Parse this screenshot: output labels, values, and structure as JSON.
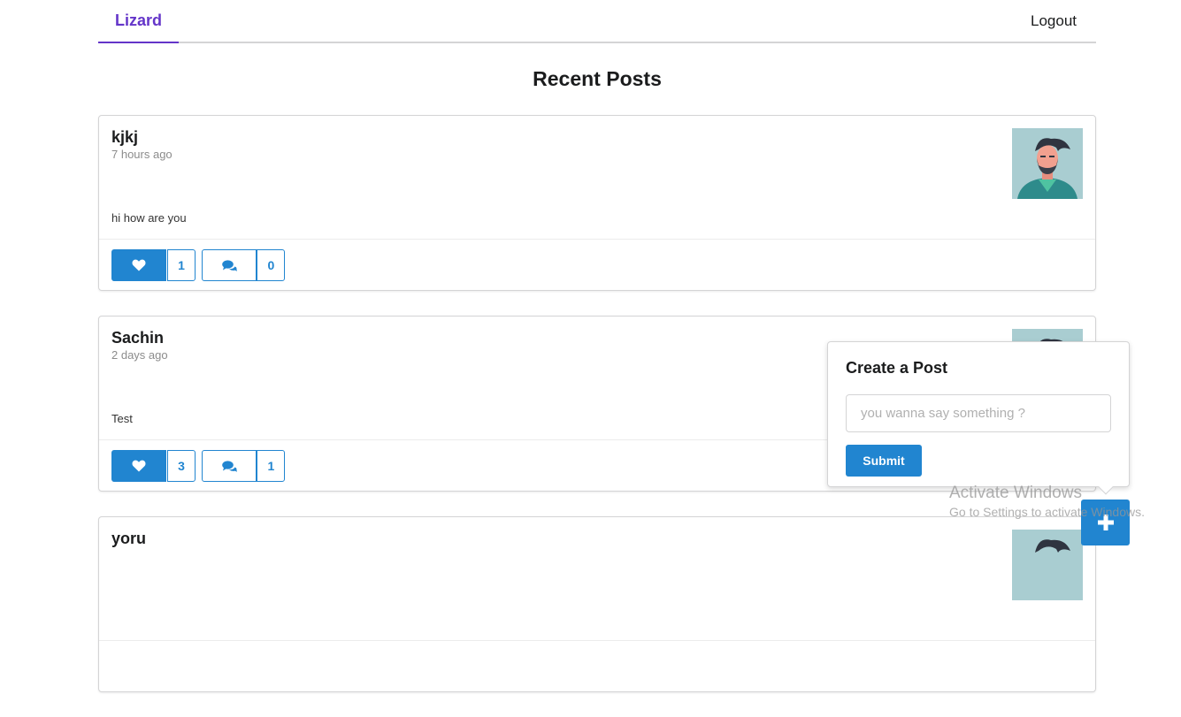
{
  "nav": {
    "brand": "Lizard",
    "logout": "Logout"
  },
  "page": {
    "title": "Recent Posts"
  },
  "posts": [
    {
      "author": "kjkj",
      "time": "7 hours ago",
      "body": "hi how are you",
      "likes": "1",
      "comments": "0"
    },
    {
      "author": "Sachin",
      "time": "2 days ago",
      "body": "Test",
      "likes": "3",
      "comments": "1"
    },
    {
      "author": "yoru",
      "time": "",
      "body": "",
      "likes": "",
      "comments": ""
    }
  ],
  "create_post": {
    "title": "Create a Post",
    "placeholder": "you wanna say something ?",
    "submit": "Submit"
  },
  "icons": {
    "like": "heart-icon",
    "comment": "comments-icon",
    "fab": "plus-icon"
  },
  "colors": {
    "brand": "#6435c9",
    "primary": "#2185d0"
  },
  "watermark": {
    "line1": "Activate Windows",
    "line2": "Go to Settings to activate Windows."
  }
}
